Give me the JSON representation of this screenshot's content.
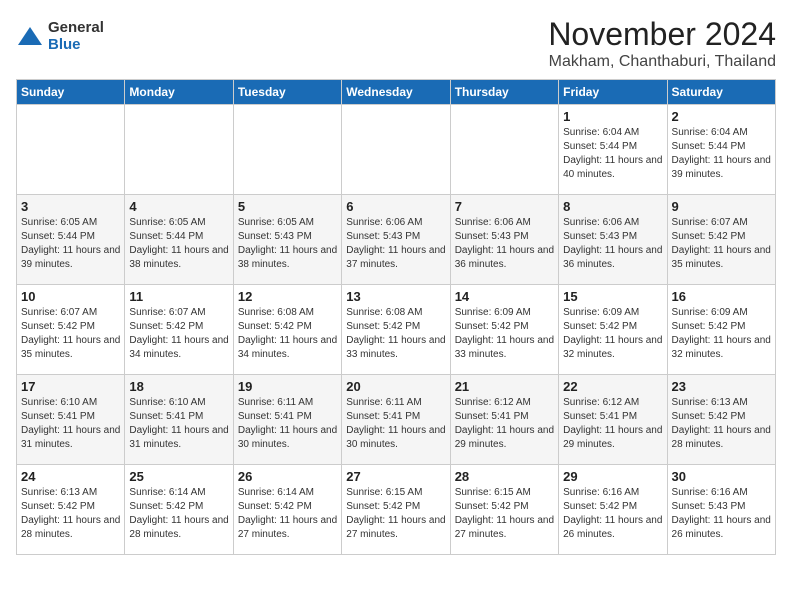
{
  "logo": {
    "general": "General",
    "blue": "Blue"
  },
  "header": {
    "month": "November 2024",
    "location": "Makham, Chanthaburi, Thailand"
  },
  "days_of_week": [
    "Sunday",
    "Monday",
    "Tuesday",
    "Wednesday",
    "Thursday",
    "Friday",
    "Saturday"
  ],
  "weeks": [
    [
      {
        "day": "",
        "info": ""
      },
      {
        "day": "",
        "info": ""
      },
      {
        "day": "",
        "info": ""
      },
      {
        "day": "",
        "info": ""
      },
      {
        "day": "",
        "info": ""
      },
      {
        "day": "1",
        "info": "Sunrise: 6:04 AM\nSunset: 5:44 PM\nDaylight: 11 hours and 40 minutes."
      },
      {
        "day": "2",
        "info": "Sunrise: 6:04 AM\nSunset: 5:44 PM\nDaylight: 11 hours and 39 minutes."
      }
    ],
    [
      {
        "day": "3",
        "info": "Sunrise: 6:05 AM\nSunset: 5:44 PM\nDaylight: 11 hours and 39 minutes."
      },
      {
        "day": "4",
        "info": "Sunrise: 6:05 AM\nSunset: 5:44 PM\nDaylight: 11 hours and 38 minutes."
      },
      {
        "day": "5",
        "info": "Sunrise: 6:05 AM\nSunset: 5:43 PM\nDaylight: 11 hours and 38 minutes."
      },
      {
        "day": "6",
        "info": "Sunrise: 6:06 AM\nSunset: 5:43 PM\nDaylight: 11 hours and 37 minutes."
      },
      {
        "day": "7",
        "info": "Sunrise: 6:06 AM\nSunset: 5:43 PM\nDaylight: 11 hours and 36 minutes."
      },
      {
        "day": "8",
        "info": "Sunrise: 6:06 AM\nSunset: 5:43 PM\nDaylight: 11 hours and 36 minutes."
      },
      {
        "day": "9",
        "info": "Sunrise: 6:07 AM\nSunset: 5:42 PM\nDaylight: 11 hours and 35 minutes."
      }
    ],
    [
      {
        "day": "10",
        "info": "Sunrise: 6:07 AM\nSunset: 5:42 PM\nDaylight: 11 hours and 35 minutes."
      },
      {
        "day": "11",
        "info": "Sunrise: 6:07 AM\nSunset: 5:42 PM\nDaylight: 11 hours and 34 minutes."
      },
      {
        "day": "12",
        "info": "Sunrise: 6:08 AM\nSunset: 5:42 PM\nDaylight: 11 hours and 34 minutes."
      },
      {
        "day": "13",
        "info": "Sunrise: 6:08 AM\nSunset: 5:42 PM\nDaylight: 11 hours and 33 minutes."
      },
      {
        "day": "14",
        "info": "Sunrise: 6:09 AM\nSunset: 5:42 PM\nDaylight: 11 hours and 33 minutes."
      },
      {
        "day": "15",
        "info": "Sunrise: 6:09 AM\nSunset: 5:42 PM\nDaylight: 11 hours and 32 minutes."
      },
      {
        "day": "16",
        "info": "Sunrise: 6:09 AM\nSunset: 5:42 PM\nDaylight: 11 hours and 32 minutes."
      }
    ],
    [
      {
        "day": "17",
        "info": "Sunrise: 6:10 AM\nSunset: 5:41 PM\nDaylight: 11 hours and 31 minutes."
      },
      {
        "day": "18",
        "info": "Sunrise: 6:10 AM\nSunset: 5:41 PM\nDaylight: 11 hours and 31 minutes."
      },
      {
        "day": "19",
        "info": "Sunrise: 6:11 AM\nSunset: 5:41 PM\nDaylight: 11 hours and 30 minutes."
      },
      {
        "day": "20",
        "info": "Sunrise: 6:11 AM\nSunset: 5:41 PM\nDaylight: 11 hours and 30 minutes."
      },
      {
        "day": "21",
        "info": "Sunrise: 6:12 AM\nSunset: 5:41 PM\nDaylight: 11 hours and 29 minutes."
      },
      {
        "day": "22",
        "info": "Sunrise: 6:12 AM\nSunset: 5:41 PM\nDaylight: 11 hours and 29 minutes."
      },
      {
        "day": "23",
        "info": "Sunrise: 6:13 AM\nSunset: 5:42 PM\nDaylight: 11 hours and 28 minutes."
      }
    ],
    [
      {
        "day": "24",
        "info": "Sunrise: 6:13 AM\nSunset: 5:42 PM\nDaylight: 11 hours and 28 minutes."
      },
      {
        "day": "25",
        "info": "Sunrise: 6:14 AM\nSunset: 5:42 PM\nDaylight: 11 hours and 28 minutes."
      },
      {
        "day": "26",
        "info": "Sunrise: 6:14 AM\nSunset: 5:42 PM\nDaylight: 11 hours and 27 minutes."
      },
      {
        "day": "27",
        "info": "Sunrise: 6:15 AM\nSunset: 5:42 PM\nDaylight: 11 hours and 27 minutes."
      },
      {
        "day": "28",
        "info": "Sunrise: 6:15 AM\nSunset: 5:42 PM\nDaylight: 11 hours and 27 minutes."
      },
      {
        "day": "29",
        "info": "Sunrise: 6:16 AM\nSunset: 5:42 PM\nDaylight: 11 hours and 26 minutes."
      },
      {
        "day": "30",
        "info": "Sunrise: 6:16 AM\nSunset: 5:43 PM\nDaylight: 11 hours and 26 minutes."
      }
    ]
  ]
}
